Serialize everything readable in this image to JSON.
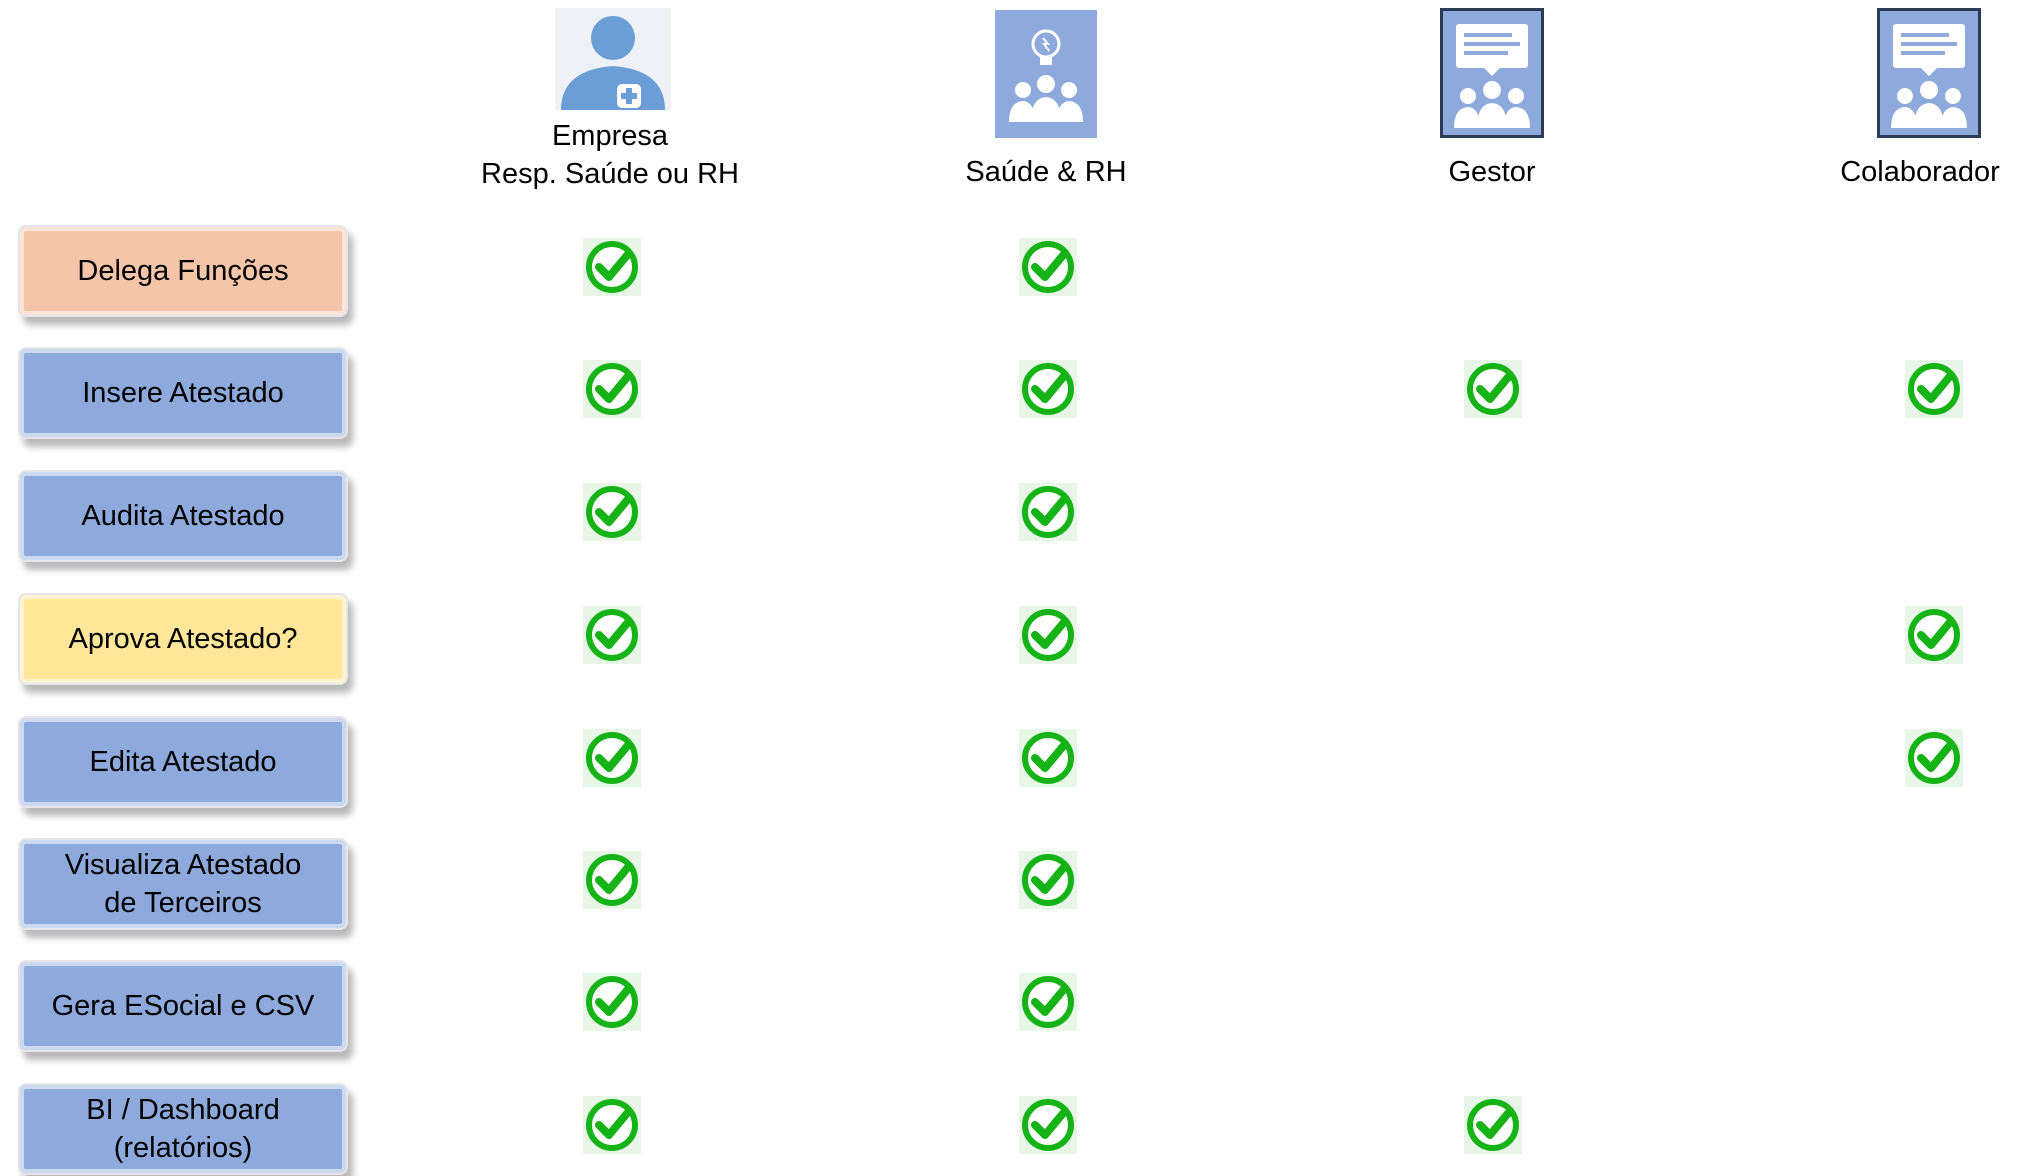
{
  "colors": {
    "delegate_box": "#f4c5a8",
    "default_box": "#8eaadc",
    "approve_box": "#ffe699",
    "check_green": "#16b316",
    "icon_blue": "#6b9ed6",
    "icon_dark_border": "#2d3b57"
  },
  "roles": [
    {
      "icon": "doctor-user-icon",
      "line1": "Empresa",
      "line2": "Resp. Saúde ou RH"
    },
    {
      "icon": "lightbulb-team-icon",
      "line1": "Saúde & RH",
      "line2": ""
    },
    {
      "icon": "presentation-team-icon",
      "line1": "Gestor",
      "line2": ""
    },
    {
      "icon": "presentation-team-icon",
      "line1": "Colaborador",
      "line2": ""
    }
  ],
  "functions": [
    {
      "label_line1": "Delega Funções",
      "label_line2": "",
      "style": "delegate",
      "checks": [
        true,
        true,
        false,
        false
      ]
    },
    {
      "label_line1": "Insere Atestado",
      "label_line2": "",
      "style": "default",
      "checks": [
        true,
        true,
        true,
        true
      ]
    },
    {
      "label_line1": "Audita Atestado",
      "label_line2": "",
      "style": "default",
      "checks": [
        true,
        true,
        false,
        false
      ]
    },
    {
      "label_line1": "Aprova Atestado?",
      "label_line2": "",
      "style": "approve",
      "checks": [
        true,
        true,
        false,
        true
      ]
    },
    {
      "label_line1": "Edita Atestado",
      "label_line2": "",
      "style": "default",
      "checks": [
        true,
        true,
        false,
        true
      ]
    },
    {
      "label_line1": "Visualiza Atestado",
      "label_line2": "de Terceiros",
      "style": "default",
      "checks": [
        true,
        true,
        false,
        false
      ]
    },
    {
      "label_line1": "Gera ESocial e CSV",
      "label_line2": "",
      "style": "default",
      "checks": [
        true,
        true,
        false,
        false
      ]
    },
    {
      "label_line1": "BI / Dashboard",
      "label_line2": "(relatórios)",
      "style": "default",
      "checks": [
        true,
        true,
        true,
        false
      ]
    }
  ]
}
